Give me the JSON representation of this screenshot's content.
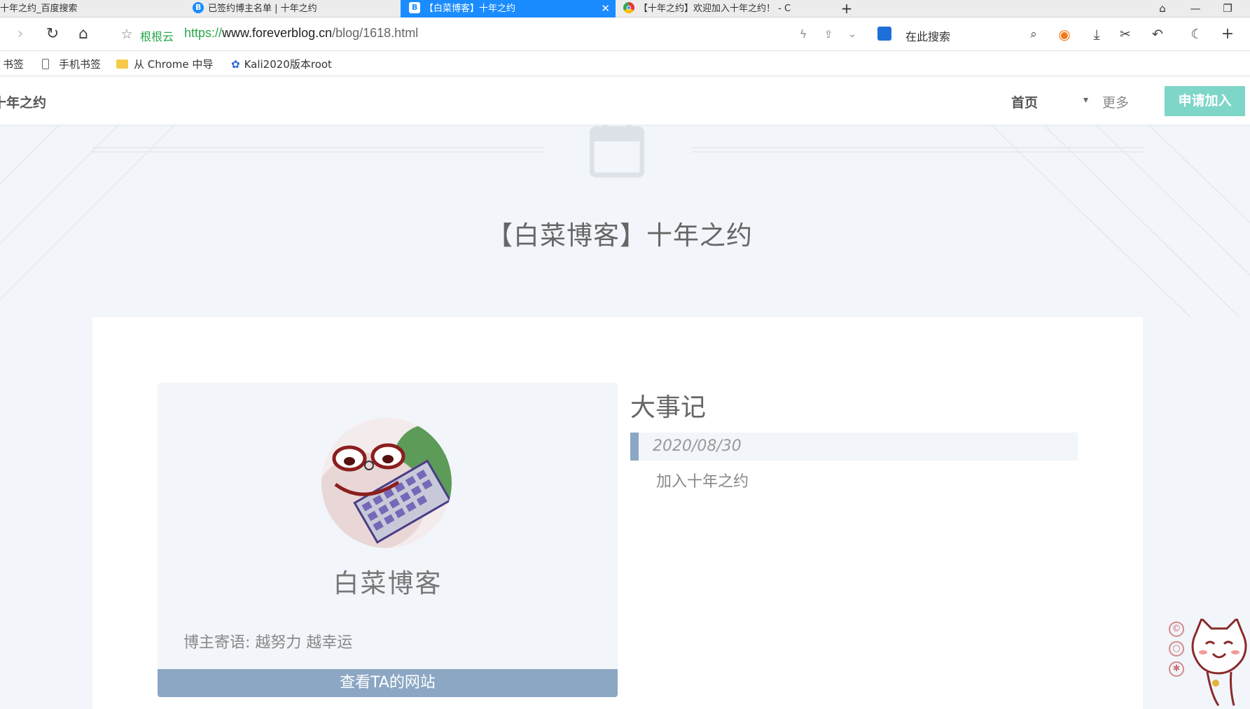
{
  "tabs": [
    {
      "label": "十年之约_百度搜索",
      "active": false
    },
    {
      "label": "已签约博主名单 | 十年之约",
      "active": false
    },
    {
      "label": "【白菜博客】十年之约",
      "active": true
    },
    {
      "label": "【十年之约】欢迎加入十年之约！ - C",
      "active": false
    }
  ],
  "toolbar": {
    "url_prefix_label": "根根云",
    "url_scheme": "https://",
    "url_domain": "www.foreverblog.cn",
    "url_path": "/blog/1618.html",
    "search_placeholder": "在此搜索",
    "new_tab_symbol": "+"
  },
  "bookmarks": [
    {
      "label": "书签",
      "icon": "none"
    },
    {
      "label": "手机书签",
      "icon": "phone-icon"
    },
    {
      "label": "从 Chrome 中导",
      "icon": "folder-icon"
    },
    {
      "label": "Kali2020版本root",
      "icon": "paw-icon"
    }
  ],
  "site": {
    "brand": "十年之约",
    "nav_home": "首页",
    "nav_more": "更多",
    "join_button": "申请加入"
  },
  "page": {
    "title": "【白菜博客】十年之约",
    "blog_name": "白菜博客",
    "motto": "博主寄语: 越努力 越幸运",
    "visit_button": "查看TA的网站",
    "events_title": "大事记",
    "events": [
      {
        "date": "2020/08/30",
        "description": "加入十年之约"
      }
    ]
  },
  "colors": {
    "active_tab": "#1a8cff",
    "accent_teal": "#7ed6c9",
    "slate_blue": "#8ba7c4",
    "page_bg": "#f2f5fa"
  }
}
